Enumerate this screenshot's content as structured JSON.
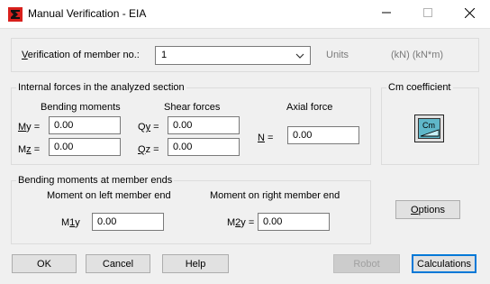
{
  "window": {
    "title": "Manual Verification - EIA",
    "minimize_icon": "minimize-icon",
    "maximize_icon": "maximize-icon",
    "close_icon": "close-icon"
  },
  "member": {
    "label_prefix": "V",
    "label_rest": "erification of member no.:",
    "selected": "1",
    "units_label": "Units",
    "units_value": "(kN) (kN*m)"
  },
  "internal_forces": {
    "title": "Internal forces in the analyzed section",
    "bending_title": "Bending moments",
    "shear_title": "Shear forces",
    "axial_title": "Axial force",
    "my": {
      "label_u": "M",
      "label_rest": "y =",
      "value": "0.00"
    },
    "mz": {
      "label_a": "M",
      "label_u": "z",
      "label_rest": " =",
      "value": "0.00"
    },
    "qy": {
      "label_a": "Q",
      "label_u": "y",
      "label_rest": " =",
      "value": "0.00"
    },
    "qz": {
      "label_u": "Q",
      "label_rest": "z =",
      "value": "0.00"
    },
    "n": {
      "label_u": "N",
      "label_rest": " =",
      "value": "0.00"
    }
  },
  "cm": {
    "title": "Cm coefficient",
    "button_text": "Cm"
  },
  "member_ends": {
    "title": "Bending moments at member ends",
    "left_title": "Moment on left member end",
    "right_title": "Moment on right member end",
    "m1y": {
      "label_a": "M",
      "label_u": "1",
      "label_rest": "y",
      "value": "0.00"
    },
    "m2y": {
      "label_a": "M",
      "label_u": "2",
      "label_rest": "y =",
      "value": "0.00"
    }
  },
  "buttons": {
    "options": {
      "u": "O",
      "rest": "ptions"
    },
    "ok": "OK",
    "cancel": "Cancel",
    "help": "Help",
    "robot": "Robot",
    "calculations": "Calculations"
  }
}
